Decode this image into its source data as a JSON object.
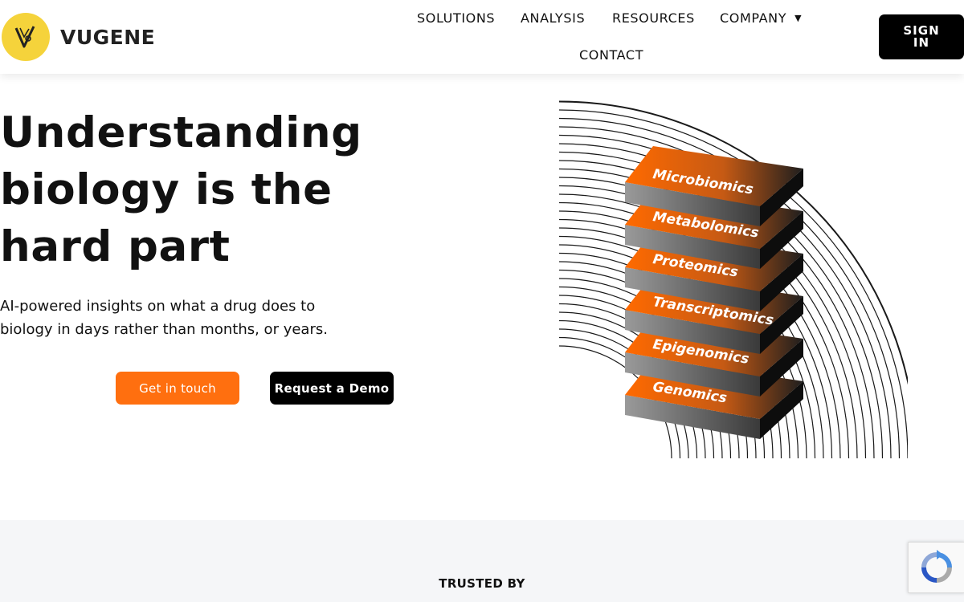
{
  "brand": {
    "name": "VUGENE",
    "logo_color": "#f5d33b"
  },
  "nav": {
    "items": [
      {
        "label": "SOLUTIONS"
      },
      {
        "label": "ANALYSIS"
      },
      {
        "label": "RESOURCES"
      },
      {
        "label": "COMPANY"
      },
      {
        "label": "CONTACT"
      }
    ],
    "company_dropdown_icon": "caret-down-icon",
    "sign_in_label": "SIGN IN"
  },
  "hero": {
    "title_lines": [
      "Understanding",
      "biology is the",
      "hard part"
    ],
    "subtitle": "AI-powered insights on what a drug does to biology in days rather than months, or years.",
    "primary_cta": "Get in touch",
    "secondary_cta": "Request a Demo",
    "layers": [
      "Microbiomics",
      "Metabolomics",
      "Proteomics",
      "Transcriptomics",
      "Epigenomics",
      "Genomics"
    ]
  },
  "trusted": {
    "label": "TRUSTED BY"
  },
  "colors": {
    "accent": "#ff6f0f",
    "dark": "#000000",
    "band": "#f5f6f8"
  },
  "recaptcha_icon": "recaptcha-icon"
}
